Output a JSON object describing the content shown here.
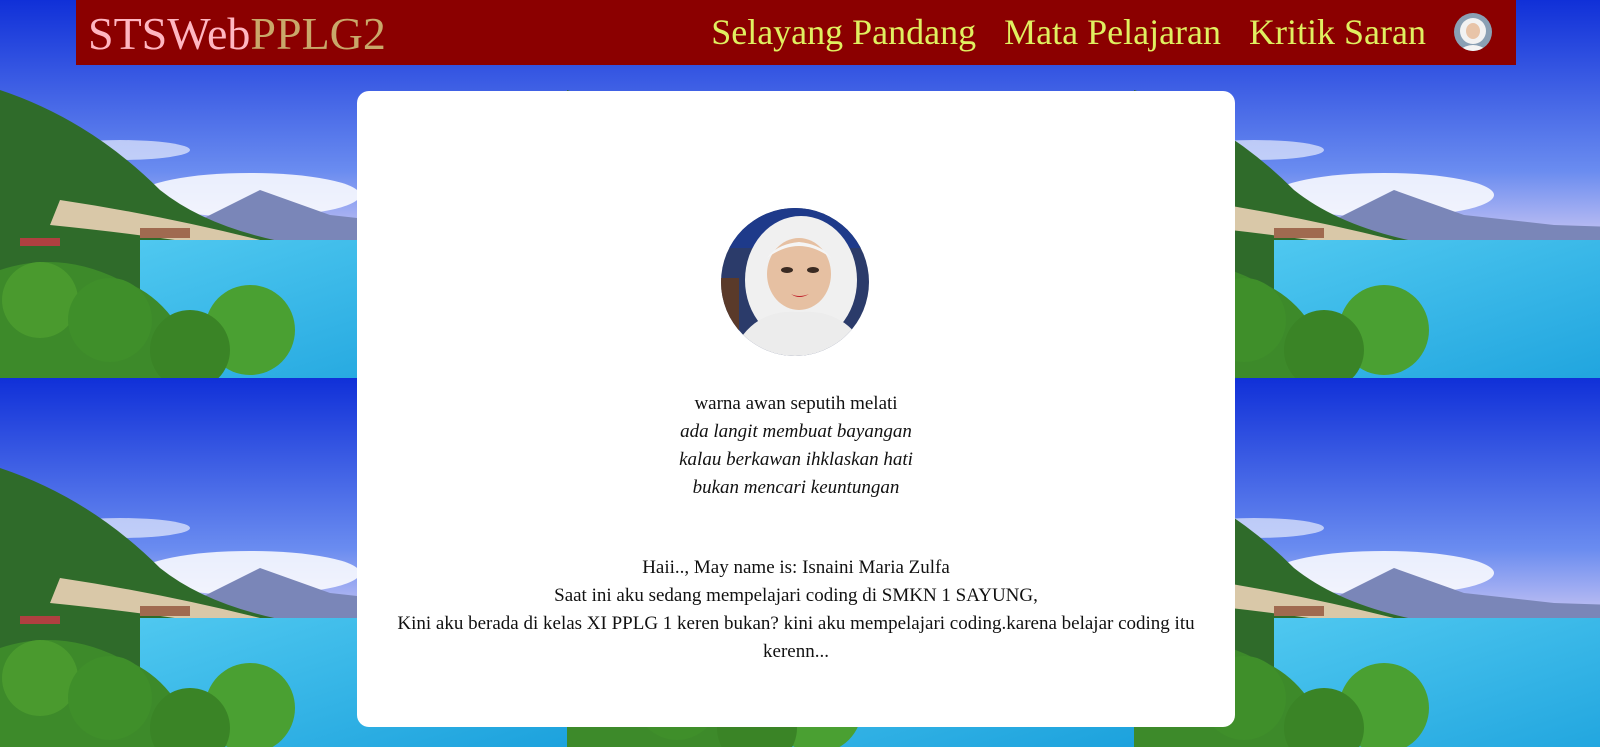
{
  "brand": {
    "part1": "STSWeb",
    "part2": "PPLG2"
  },
  "nav": {
    "items": [
      {
        "label": "Selayang Pandang"
      },
      {
        "label": "Mata Pelajaran"
      },
      {
        "label": "Kritik Saran"
      }
    ]
  },
  "poem": {
    "lines": [
      "warna awan seputih melati",
      "ada langit membuat bayangan",
      "kalau berkawan ihklaskan hati",
      "bukan mencari keuntungan"
    ]
  },
  "intro": {
    "line1": "Haii.., May name is: Isnaini Maria Zulfa",
    "line2": "Saat ini aku sedang mempelajari coding di SMKN 1 SAYUNG,",
    "line3": "Kini aku berada di kelas XI PPLG 1 keren bukan? kini aku mempelajari coding.karena belajar coding itu kerenn..."
  },
  "colors": {
    "navbar_bg": "#8b0000",
    "brand_part1": "#ffb6c1",
    "brand_part2": "#c9a86a",
    "nav_link": "#e0f060",
    "card_bg": "#ffffff"
  },
  "icons": {
    "nav_avatar": "profile-avatar-icon",
    "profile_photo": "profile-photo"
  }
}
